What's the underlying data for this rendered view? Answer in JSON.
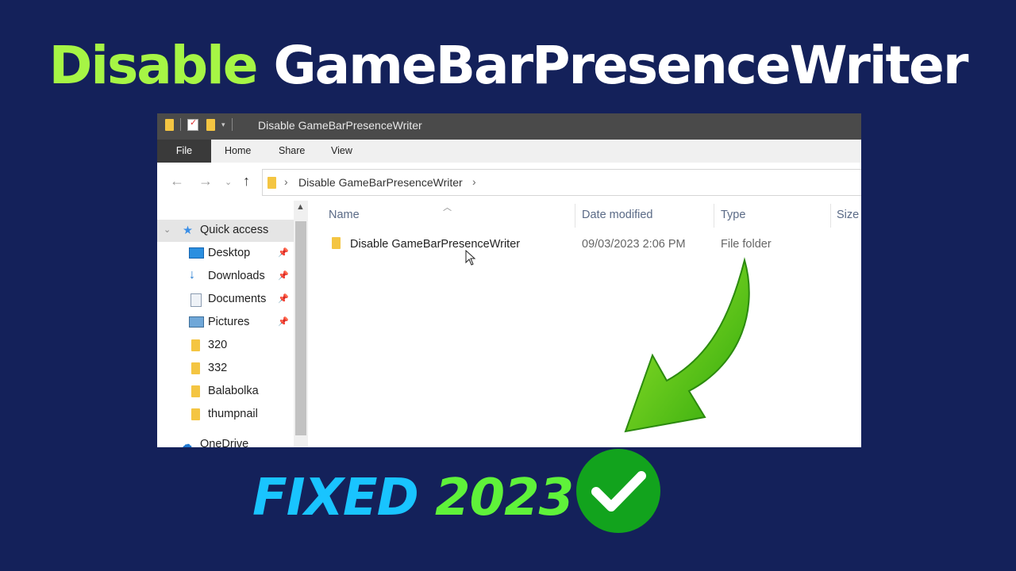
{
  "headline": {
    "word1": "Disable",
    "word2": "GameBarPresenceWriter"
  },
  "window": {
    "title": "Disable GameBarPresenceWriter",
    "ribbon_tabs": [
      "File",
      "Home",
      "Share",
      "View"
    ],
    "address_path": "Disable GameBarPresenceWriter",
    "sidebar": {
      "quick_access": "Quick access",
      "items": [
        {
          "label": "Desktop",
          "icon": "desktop-icon",
          "pinned": true
        },
        {
          "label": "Downloads",
          "icon": "download-icon",
          "pinned": true
        },
        {
          "label": "Documents",
          "icon": "documents-icon",
          "pinned": true
        },
        {
          "label": "Pictures",
          "icon": "pictures-icon",
          "pinned": true
        },
        {
          "label": "320",
          "icon": "folder-icon",
          "pinned": false
        },
        {
          "label": "332",
          "icon": "folder-icon",
          "pinned": false
        },
        {
          "label": "Balabolka",
          "icon": "folder-icon",
          "pinned": false
        },
        {
          "label": "thumpnail",
          "icon": "folder-icon",
          "pinned": false
        },
        {
          "label": "OneDrive",
          "icon": "cloud-icon",
          "pinned": false
        }
      ]
    },
    "columns": [
      "Name",
      "Date modified",
      "Type",
      "Size"
    ],
    "rows": [
      {
        "name": "Disable GameBarPresenceWriter",
        "date": "09/03/2023 2:06 PM",
        "type": "File folder"
      }
    ]
  },
  "banner": {
    "fixed": "FIXED",
    "year": "2023"
  },
  "colors": {
    "background": "#14215a",
    "green": "#a6f545",
    "cyan": "#19c4ff",
    "check_green": "#12a31d"
  }
}
